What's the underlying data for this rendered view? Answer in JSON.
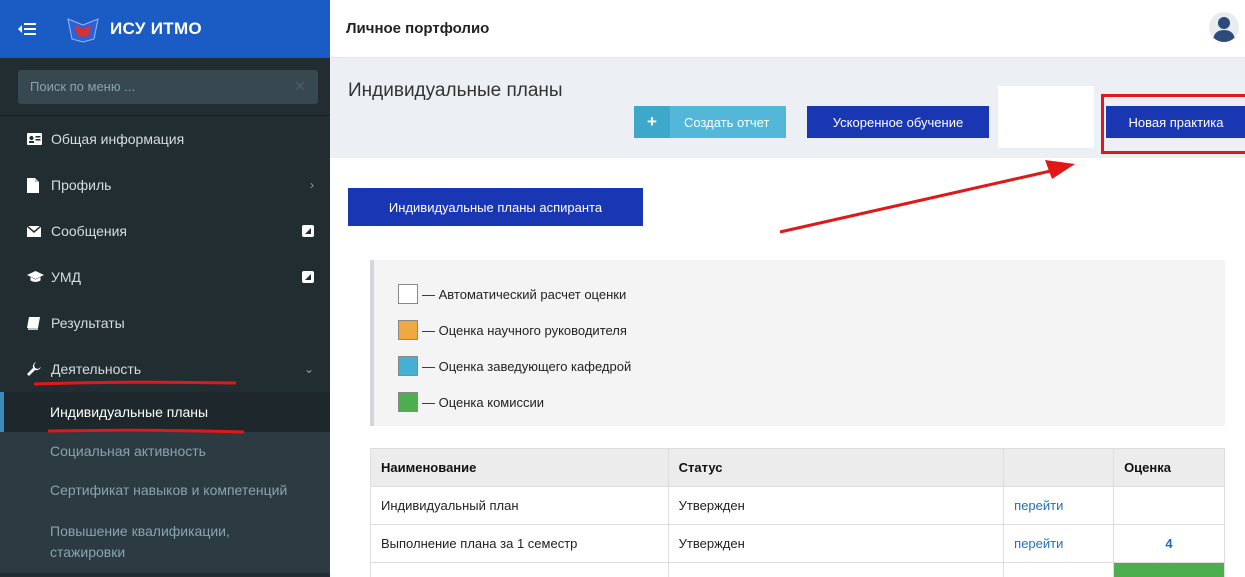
{
  "sidebar": {
    "brand_title": "ИСУ ИТМО",
    "search_placeholder": "Поиск по меню ...",
    "items": [
      {
        "label": "Общая информация",
        "icon": "id-card-icon"
      },
      {
        "label": "Профиль",
        "icon": "file-icon",
        "indicator": "›"
      },
      {
        "label": "Сообщения",
        "icon": "envelope-icon",
        "indicator": "external-link-icon"
      },
      {
        "label": "УМД",
        "icon": "graduation-cap-icon",
        "indicator": "external-link-icon"
      },
      {
        "label": "Результаты",
        "icon": "book-icon"
      },
      {
        "label": "Деятельность",
        "icon": "wrench-icon",
        "indicator": "⌄"
      }
    ],
    "subitems": [
      {
        "label": "Индивидуальные планы",
        "active": true
      },
      {
        "label": "Социальная активность"
      },
      {
        "label": "Сертификат навыков и компетенций"
      },
      {
        "label_line1": "Повышение квалификации,",
        "label_line2": "стажировки"
      }
    ]
  },
  "topbar": {
    "page_title": "Личное портфолио"
  },
  "content": {
    "heading": "Индивидуальные планы",
    "buttons": {
      "create_report": "Создать отчет",
      "accelerated": "Ускоренное обучение",
      "new_practice": "Новая практика",
      "aspirant_plans": "Индивидуальные планы аспиранта"
    },
    "legend": [
      {
        "label": "— Автоматический расчет оценки",
        "color": "#ffffff"
      },
      {
        "label": "— Оценка научного руководителя",
        "color": "#f0a840"
      },
      {
        "label": "— Оценка заведующего кафедрой",
        "color": "#46b0d4"
      },
      {
        "label": "— Оценка комиссии",
        "color": "#4cae4c"
      }
    ],
    "table": {
      "headers": [
        "Наименование",
        "Статус",
        "",
        "Оценка"
      ],
      "rows": [
        {
          "name": "Индивидуальный план",
          "status": "Утвержден",
          "link": "перейти",
          "score": ""
        },
        {
          "name": "Выполнение плана за 1 семестр",
          "status": "Утвержден",
          "link": "перейти",
          "score": "4"
        }
      ]
    }
  },
  "colors": {
    "brand": "#1b5bc4",
    "sidebar": "#222d32",
    "button_primary": "#1936b3",
    "button_info": "#52b7d8",
    "annotation": "#e01818"
  }
}
